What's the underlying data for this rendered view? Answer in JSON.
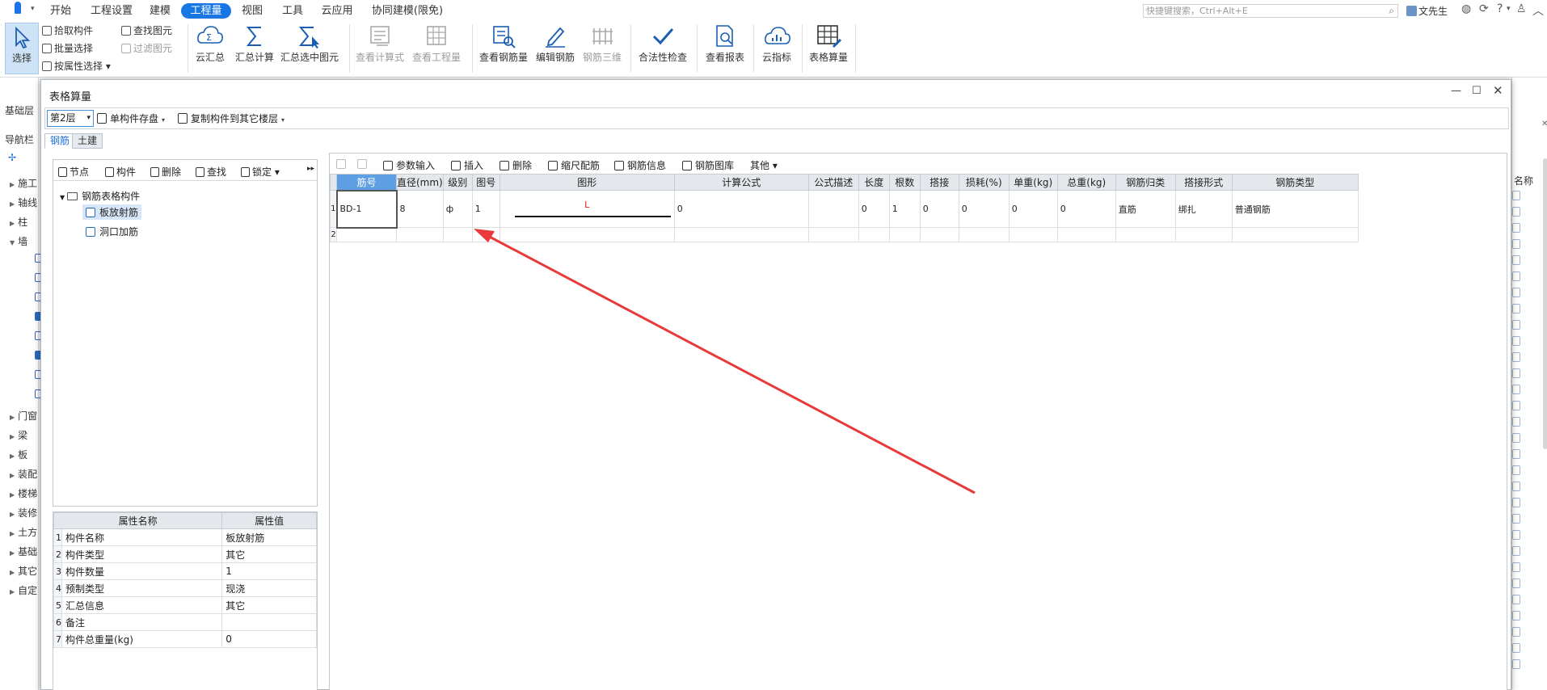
{
  "menu": {
    "tabs": [
      "开始",
      "工程设置",
      "建模",
      "工程量",
      "视图",
      "工具",
      "云应用",
      "协同建模(限免)"
    ],
    "active": "工程量",
    "search_placeholder": "快捷键搜索，Ctrl+Alt+E",
    "user": "文先生",
    "help": "?"
  },
  "ribbon": {
    "select": "选择",
    "pick": "拾取构件",
    "batch": "批量选择",
    "by_prop": "按属性选择",
    "find": "查找图元",
    "filter": "过滤图元",
    "cloud_sum": "云汇总",
    "sum_calc": "汇总计算",
    "sum_sel": "汇总选中图元",
    "view_formula": "查看计算式",
    "view_qty": "查看工程量",
    "view_rebar": "查看钢筋量",
    "edit_rebar": "编辑钢筋",
    "rebar_3d": "钢筋三维",
    "legal_check": "合法性检查",
    "view_report": "查看报表",
    "cloud_index": "云指标",
    "table_calc": "表格算量"
  },
  "left_bg": {
    "tab1": "基础层",
    "tab2": "导航栏",
    "items": [
      "施工",
      "轴线",
      "柱",
      "墙",
      "门窗",
      "梁",
      "板",
      "装配",
      "楼梯",
      "装修",
      "土方",
      "基础",
      "其它",
      "自定"
    ]
  },
  "right_bg": {
    "header": "名称"
  },
  "dialog": {
    "title": "表格算量",
    "floor": "第2层",
    "save_single": "单构件存盘",
    "copy_to_floor": "复制构件到其它楼层",
    "tab_rebar": "钢筋",
    "tab_civil": "土建",
    "tree_tools": [
      "节点",
      "构件",
      "删除",
      "查找",
      "锁定"
    ],
    "tree_root": "钢筋表格构件",
    "tree_children": [
      "板放射筋",
      "洞口加筋"
    ],
    "props": {
      "headers": [
        "属性名称",
        "属性值"
      ],
      "rows": [
        {
          "n": "1",
          "name": "构件名称",
          "value": "板放射筋"
        },
        {
          "n": "2",
          "name": "构件类型",
          "value": "其它"
        },
        {
          "n": "3",
          "name": "构件数量",
          "value": "1"
        },
        {
          "n": "4",
          "name": "预制类型",
          "value": "现浇"
        },
        {
          "n": "5",
          "name": "汇总信息",
          "value": "其它"
        },
        {
          "n": "6",
          "name": "备注",
          "value": ""
        },
        {
          "n": "7",
          "name": "构件总重量(kg)",
          "value": "0"
        }
      ]
    },
    "grid_tools": [
      "参数输入",
      "插入",
      "删除",
      "缩尺配筋",
      "钢筋信息",
      "钢筋图库",
      "其他"
    ],
    "grid": {
      "headers": [
        "筋号",
        "直径(mm)",
        "级别",
        "图号",
        "图形",
        "计算公式",
        "公式描述",
        "长度",
        "根数",
        "搭接",
        "损耗(%)",
        "单重(kg)",
        "总重(kg)",
        "钢筋归类",
        "搭接形式",
        "钢筋类型"
      ],
      "rows": [
        {
          "n": "1",
          "cells": [
            "BD-1",
            "8",
            "ф",
            "1",
            "L",
            "0",
            "",
            "0",
            "1",
            "0",
            "0",
            "0",
            "0",
            "直筋",
            "绑扎",
            "普通钢筋"
          ]
        },
        {
          "n": "2",
          "cells": [
            "",
            "",
            "",
            "",
            "",
            "",
            "",
            "",
            "",
            "",
            "",
            "",
            "",
            "",
            "",
            ""
          ]
        }
      ]
    }
  }
}
